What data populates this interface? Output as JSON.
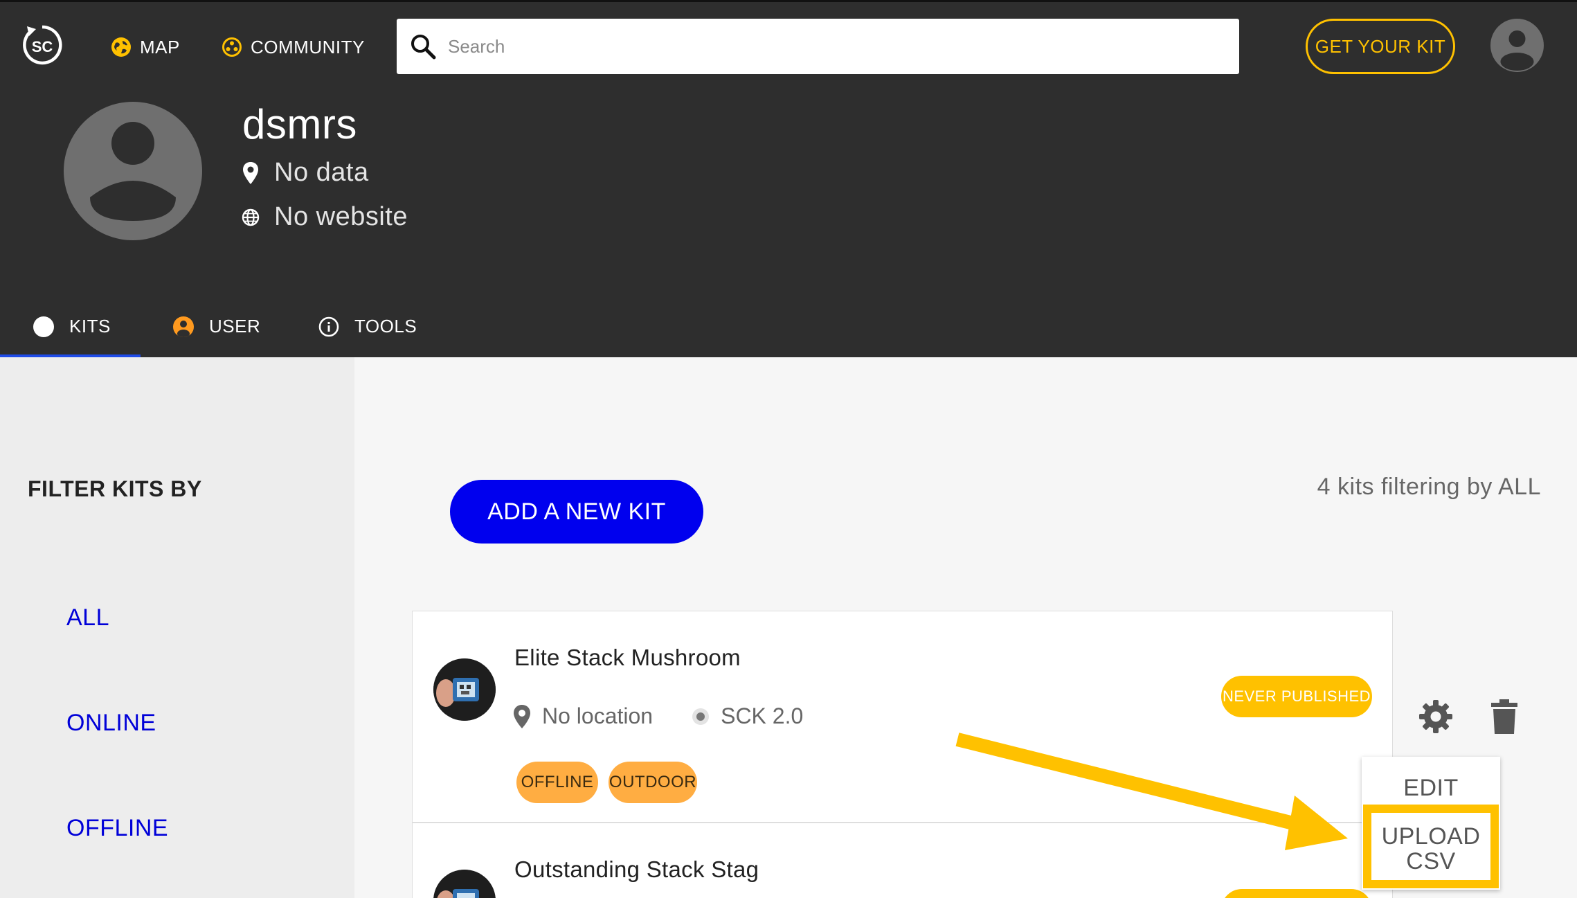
{
  "header": {
    "logo_text": "SC",
    "nav": [
      {
        "label": "MAP",
        "icon": "globe-icon"
      },
      {
        "label": "COMMUNITY",
        "icon": "community-icon"
      }
    ],
    "search": {
      "placeholder": "Search",
      "value": ""
    },
    "get_kit_label": "GET YOUR KIT",
    "avatar_icon": "account-circle-icon"
  },
  "profile": {
    "username": "dsmrs",
    "location": "No data",
    "website": "No website"
  },
  "tabs": [
    {
      "label": "KITS",
      "active": true
    },
    {
      "label": "USER",
      "active": false
    },
    {
      "label": "TOOLS",
      "active": false
    }
  ],
  "sidebar": {
    "title": "FILTER KITS BY",
    "filters": [
      "ALL",
      "ONLINE",
      "OFFLINE"
    ]
  },
  "main": {
    "add_kit_label": "ADD A NEW KIT",
    "kit_count_text": "4 kits filtering by ALL",
    "kits": [
      {
        "name": "Elite Stack Mushroom",
        "location": "No location",
        "hardware": "SCK 2.0",
        "status_badge": "NEVER PUBLISHED",
        "tags": [
          "OFFLINE",
          "OUTDOOR"
        ]
      },
      {
        "name": "Outstanding Stack Stag"
      }
    ],
    "menu": {
      "edit_label": "EDIT",
      "upload_line1": "UPLOAD",
      "upload_line2": "CSV"
    }
  },
  "colors": {
    "dark_bg": "#2e2e2e",
    "accent_yellow": "#ffc100",
    "primary_blue": "#0000ee",
    "tag_orange": "#ffad42",
    "link_blue": "#0000d8"
  }
}
